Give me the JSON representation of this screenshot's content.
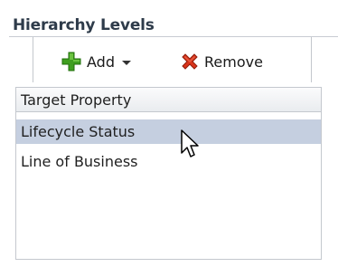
{
  "panel": {
    "title": "Hierarchy Levels"
  },
  "toolbar": {
    "add_label": "Add",
    "remove_label": "Remove",
    "add_icon": "plus-icon",
    "remove_icon": "red-x-icon",
    "add_color": "#3f9e1f",
    "remove_color": "#d9341b"
  },
  "table": {
    "header": "Target Property",
    "rows": [
      {
        "label": "Lifecycle Status",
        "selected": true
      },
      {
        "label": "Line of Business",
        "selected": false
      }
    ],
    "selection_color": "#c5cfe0"
  }
}
